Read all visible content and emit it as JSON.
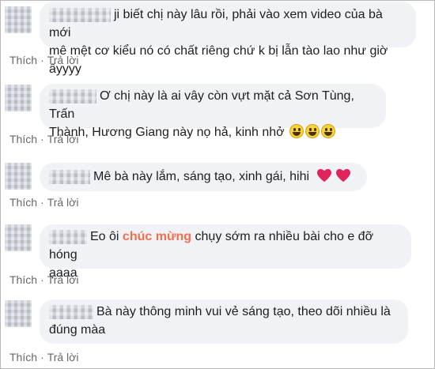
{
  "actions": {
    "like": "Thích",
    "reply": "Trả lời",
    "separator": "·"
  },
  "colors": {
    "highlight": "#f06f4f",
    "bubble": "#f0f2f5",
    "action_text": "#65676b"
  },
  "comments": [
    {
      "line1": "ji biết chị này lâu rồi, phải vào xem video của bà mới",
      "line2": "mê mệt cơ kiểu nó có chất riêng chứ k bị lẫn tào lao như giờ ấyyyy"
    },
    {
      "line1": "Ơ chị này là ai vây còn vựt mặt cả Sơn Tùng, Trấn",
      "line2": "Thành, Hương Giang này nọ hả, kinh nhở",
      "emoji": [
        "grinning-emoji",
        "grinning-emoji",
        "grinning-emoji"
      ]
    },
    {
      "line1": "Mê bà này lắm, sáng tạo, xinh gái, hihi",
      "emoji": [
        "heart-emoji",
        "heart-emoji"
      ]
    },
    {
      "line1_pre": "Eo ôi ",
      "line1_highlight": "chúc mừng",
      "line1_post": " chụy sớm ra nhiều bài cho e đỡ hóng",
      "line2": "ạaaa"
    },
    {
      "line1": "Bà này thông minh vui vẻ sáng tạo, theo dõi nhiều là",
      "line2": "đúng màa"
    }
  ]
}
